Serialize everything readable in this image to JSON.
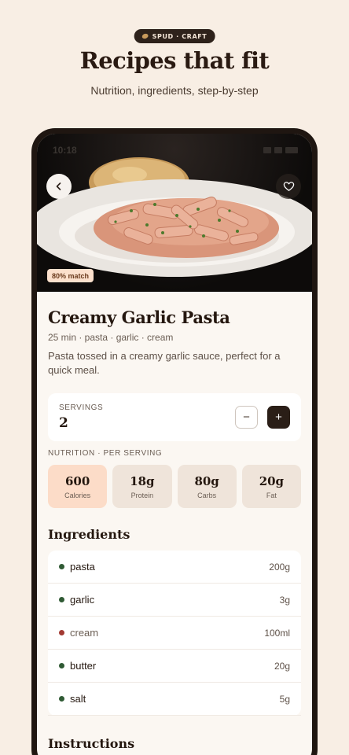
{
  "brand": {
    "label": "SPUD · CRAFT",
    "icon": "potato-icon"
  },
  "hero": {
    "title": "Recipes that fit",
    "subtitle": "Nutrition, ingredients, step-by-step"
  },
  "statusbar": {
    "time": "10:18"
  },
  "photo": {
    "match_badge": "80% match",
    "back_icon": "chevron-left-icon",
    "fav_icon": "heart-icon"
  },
  "recipe": {
    "title": "Creamy Garlic Pasta",
    "meta": "25 min · pasta · garlic · cream",
    "description": "Pasta tossed in a creamy garlic sauce, perfect for a quick meal."
  },
  "servings": {
    "label": "SERVINGS",
    "value": "2",
    "minus": "−",
    "plus": "+"
  },
  "nutrition": {
    "label": "NUTRITION · PER SERVING",
    "items": [
      {
        "value": "600",
        "name": "Calories"
      },
      {
        "value": "18g",
        "name": "Protein"
      },
      {
        "value": "80g",
        "name": "Carbs"
      },
      {
        "value": "20g",
        "name": "Fat"
      }
    ]
  },
  "ingredients": {
    "heading": "Ingredients",
    "items": [
      {
        "name": "pasta",
        "qty": "200g",
        "status_color": "#2f5a34"
      },
      {
        "name": "garlic",
        "qty": "3g",
        "status_color": "#2f5a34"
      },
      {
        "name": "cream",
        "qty": "100ml",
        "status_color": "#a23a32"
      },
      {
        "name": "butter",
        "qty": "20g",
        "status_color": "#2f5a34"
      },
      {
        "name": "salt",
        "qty": "5g",
        "status_color": "#2f5a34"
      }
    ]
  },
  "instructions": {
    "heading": "Instructions"
  },
  "colors": {
    "accent_dark": "#2a1e17",
    "highlight": "#fcdcc8",
    "background": "#f8eee4"
  }
}
